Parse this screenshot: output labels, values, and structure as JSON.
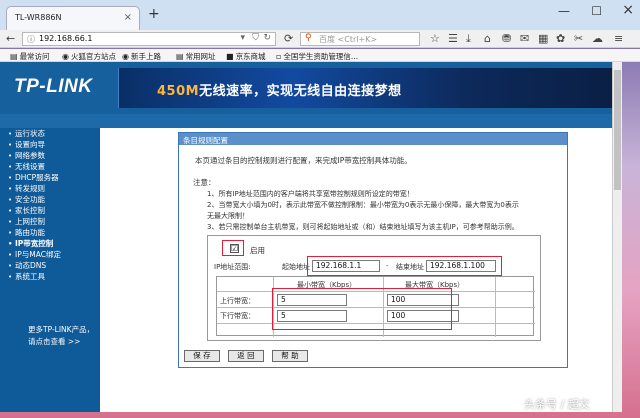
{
  "browser": {
    "tab_title": "TL-WR886N",
    "tab_close": "×",
    "new_tab": "+",
    "url": "192.168.66.1",
    "search_placeholder": "百度 <Ctrl+K>",
    "icons": {
      "back": "back-arrow-icon",
      "info": "info-icon",
      "dropdown": "chevron-down-icon",
      "reload": "reload-icon",
      "search": "search-icon",
      "bookmark": "star-icon",
      "home": "home-icon"
    },
    "bookmarks": [
      "最常访问",
      "火狐官方站点",
      "新手上路",
      "常用网址",
      "京东商城",
      "全国学生资助管理信..."
    ]
  },
  "banner": {
    "logo": "TP-LINK",
    "tag_highlight": "450M",
    "tag_text": "无线速率，实现无线自由连接梦想"
  },
  "sidebar": {
    "items": [
      {
        "label": "运行状态"
      },
      {
        "label": "设置向导"
      },
      {
        "label": "网络参数"
      },
      {
        "label": "无线设置"
      },
      {
        "label": "DHCP服务器"
      },
      {
        "label": "转发规则"
      },
      {
        "label": "安全功能"
      },
      {
        "label": "家长控制"
      },
      {
        "label": "上网控制"
      },
      {
        "label": "路由功能"
      },
      {
        "label": "IP带宽控制",
        "active": true
      },
      {
        "label": "IP与MAC绑定"
      },
      {
        "label": "动态DNS"
      },
      {
        "label": "系统工具"
      }
    ],
    "footer_line1": "更多TP-LINK产品，",
    "footer_line2": "请点击查看 >>"
  },
  "panel": {
    "title": "条目规则配置",
    "description": "本页通过条目的控制规则进行配置，来完成IP带宽控制具体功能。",
    "note_head": "注意：",
    "notes": [
      "1、所有IP地址范围内的客户端将共享宽带控制规则所设定的带宽！",
      "2、当带宽大小填为0时，表示此带宽不做控制限制：最小带宽为0表示无最小保障，最大带宽为0表示",
      "无最大限制！",
      "3、若只需控制单台主机带宽，则可将起始地址或（和）结束地址填写为该主机IP，可参考帮助示例。"
    ],
    "enable_label": "启用",
    "enabled_mark": "☑",
    "ip_range_label": "IP地址范围:",
    "start_label": "起始地址",
    "start_ip": "192.168.1.1",
    "dash": "-",
    "end_label": "结束地址",
    "end_ip": "192.168.1.100",
    "min_bw_header": "最小带宽（Kbps）",
    "max_bw_header": "最大带宽（Kbps）",
    "up_label": "上行带宽：",
    "down_label": "下行带宽：",
    "up_min": "5",
    "up_max": "100",
    "down_min": "5",
    "down_max": "100"
  },
  "buttons": {
    "save": "保 存",
    "back": "返 回",
    "help": "帮 助"
  },
  "watermark": "头条号 / 超文"
}
